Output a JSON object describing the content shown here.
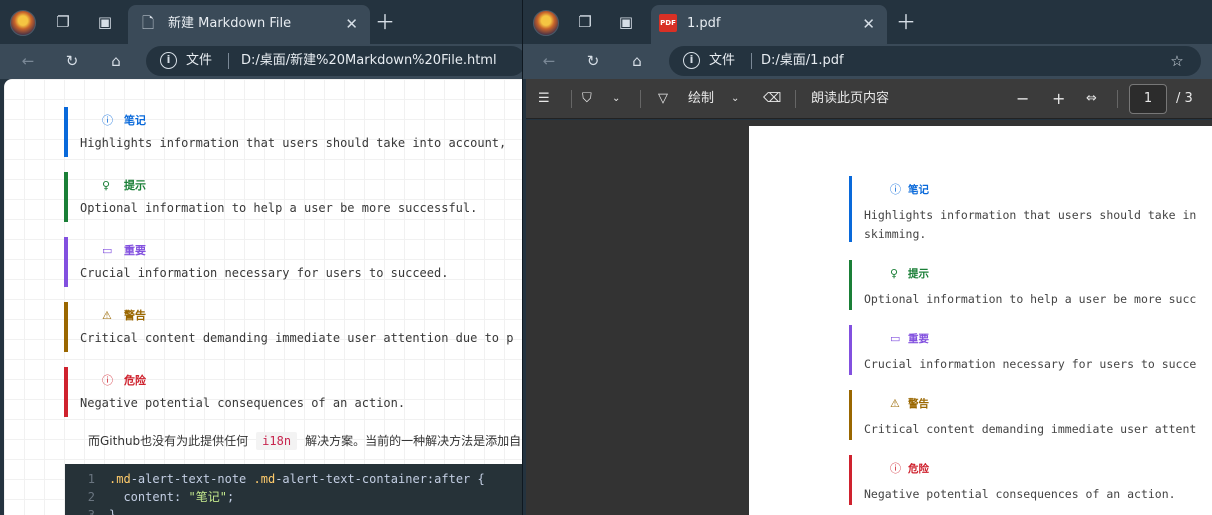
{
  "left_window": {
    "tab_title": "新建 Markdown File",
    "address": {
      "label": "文件",
      "url": "D:/桌面/新建%20Markdown%20File.html"
    }
  },
  "right_window": {
    "tab_title": "1.pdf",
    "address": {
      "label": "文件",
      "url": "D:/桌面/1.pdf"
    },
    "pdf_toolbar": {
      "draw_label": "绘制",
      "read_aloud_label": "朗读此页内容",
      "page_current": "1",
      "page_total": "/ 3"
    }
  },
  "alerts": [
    {
      "type": "note",
      "title": "笔记",
      "color": "#0969da",
      "icon": "info-icon",
      "glyph": "ⓘ",
      "text_left": "Highlights information that users should take into account,",
      "text_right": "Highlights information that users should take in",
      "text_right_2": "skimming."
    },
    {
      "type": "tip",
      "title": "提示",
      "color": "#1a7f37",
      "icon": "lightbulb-icon",
      "glyph": "♀",
      "text_left": "Optional information to help a user be more successful.",
      "text_right": "Optional information to help a user be more succ"
    },
    {
      "type": "important",
      "title": "重要",
      "color": "#8250df",
      "icon": "comment-icon",
      "glyph": "▭",
      "text_left": "Crucial information necessary for users to succeed.",
      "text_right": "Crucial information necessary for users to succe"
    },
    {
      "type": "warning",
      "title": "警告",
      "color": "#9a6700",
      "icon": "warning-icon",
      "glyph": "⚠",
      "text_left": "Critical content demanding immediate user attention due to p",
      "text_right": "Critical content demanding immediate user attent"
    },
    {
      "type": "caution",
      "title": "危险",
      "color": "#cf222e",
      "icon": "stop-icon",
      "glyph": "ⓘ",
      "text_left": "Negative potential consequences of an action.",
      "text_right": "Negative potential consequences of an action."
    }
  ],
  "paragraph": {
    "before": "而Github也没有为此提供任何",
    "code": "i18n",
    "after": "解决方案。当前的一种解决方法是添加自"
  },
  "code_lines": [
    {
      "n": "1",
      "sel": ".md",
      "rest": "-alert-text-note ",
      "sel2": ".md",
      "rest2": "-alert-text-container:after {"
    },
    {
      "n": "2",
      "prop": "  content: ",
      "val": "\"笔记\"",
      "end": ";"
    },
    {
      "n": "3",
      "text": "}"
    }
  ]
}
